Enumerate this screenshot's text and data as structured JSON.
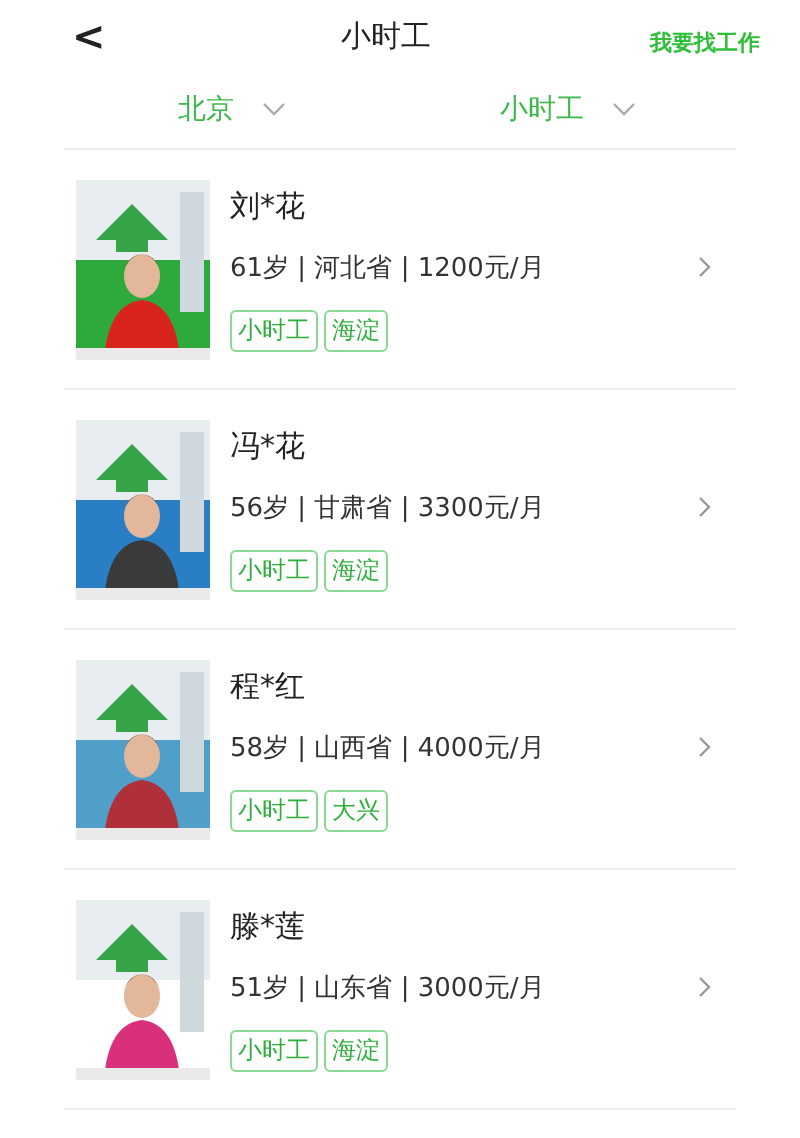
{
  "header": {
    "back": "<",
    "title": "小时工",
    "action": "我要找工作"
  },
  "filters": [
    {
      "label": "北京"
    },
    {
      "label": "小时工"
    }
  ],
  "workers": [
    {
      "name": "刘*花",
      "info": "61岁 | 河北省 | 1200元/月",
      "tags": [
        "小时工",
        "海淀"
      ]
    },
    {
      "name": "冯*花",
      "info": "56岁 | 甘肃省 | 3300元/月",
      "tags": [
        "小时工",
        "海淀"
      ]
    },
    {
      "name": "程*红",
      "info": "58岁 | 山西省 | 4000元/月",
      "tags": [
        "小时工",
        "大兴"
      ]
    },
    {
      "name": "滕*莲",
      "info": "51岁 | 山东省 | 3000元/月",
      "tags": [
        "小时工",
        "海淀"
      ]
    }
  ]
}
